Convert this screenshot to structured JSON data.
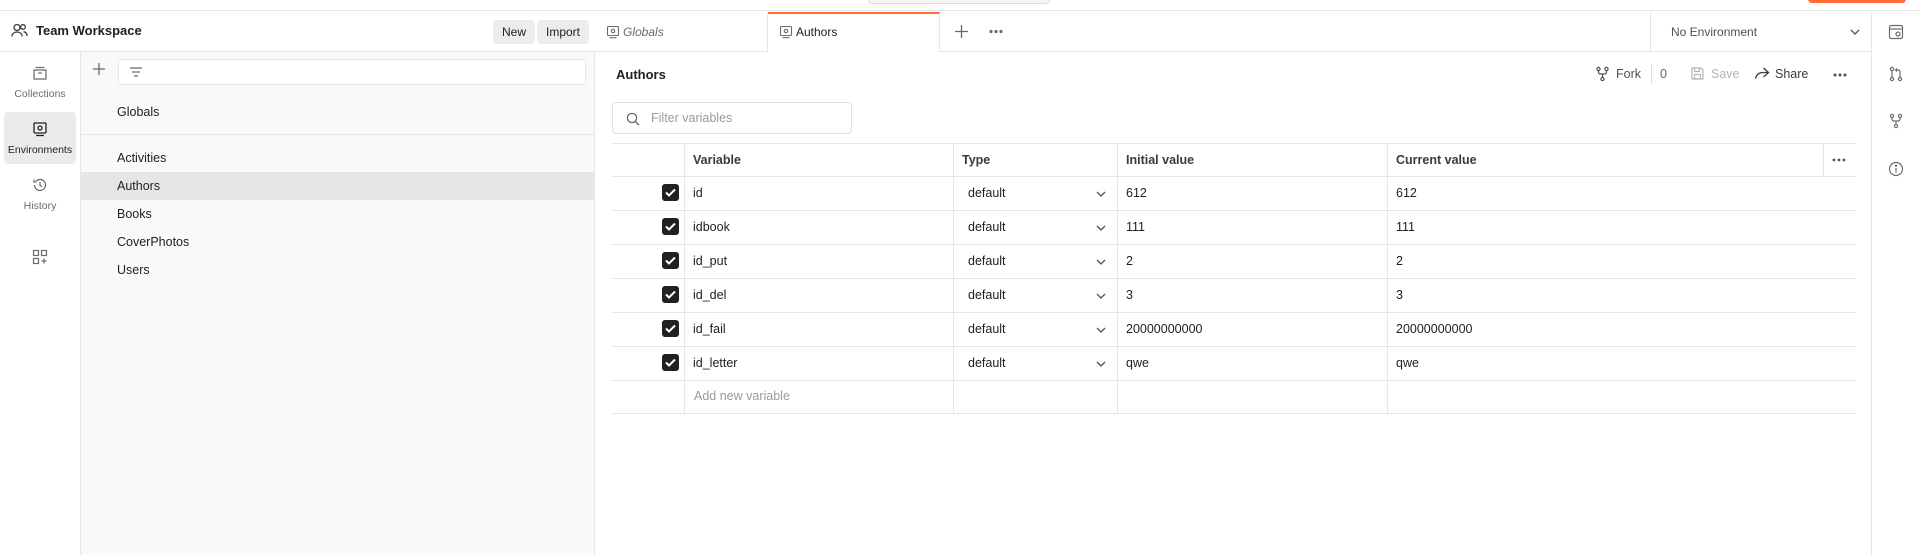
{
  "header": {
    "workspace_title": "Team Workspace",
    "new_label": "New",
    "import_label": "Import"
  },
  "rail": {
    "items": [
      {
        "label": "Collections",
        "icon": "collections-icon"
      },
      {
        "label": "Environments",
        "icon": "environments-icon"
      },
      {
        "label": "History",
        "icon": "history-icon"
      },
      {
        "label": "",
        "icon": "add-apps-icon"
      }
    ]
  },
  "environments": {
    "globals": "Globals",
    "items": [
      "Activities",
      "Authors",
      "Books",
      "CoverPhotos",
      "Users"
    ],
    "active": "Authors"
  },
  "tabs": [
    {
      "label": "Globals",
      "italic": true
    },
    {
      "label": "Authors",
      "active": true
    }
  ],
  "env_selector": {
    "label": "No Environment"
  },
  "content": {
    "title": "Authors",
    "fork_label": "Fork",
    "fork_count": "0",
    "save_label": "Save",
    "share_label": "Share",
    "search_placeholder": "Filter variables"
  },
  "table": {
    "headers": [
      "Variable",
      "Type",
      "Initial value",
      "Current value"
    ],
    "rows": [
      {
        "checked": true,
        "variable": "id",
        "type": "default",
        "initial": "612",
        "current": "612"
      },
      {
        "checked": true,
        "variable": "idbook",
        "type": "default",
        "initial": "111",
        "current": "111"
      },
      {
        "checked": true,
        "variable": "id_put",
        "type": "default",
        "initial": "2",
        "current": "2"
      },
      {
        "checked": true,
        "variable": "id_del",
        "type": "default",
        "initial": "3",
        "current": "3"
      },
      {
        "checked": true,
        "variable": "id_fail",
        "type": "default",
        "initial": "20000000000",
        "current": "20000000000"
      },
      {
        "checked": true,
        "variable": "id_letter",
        "type": "default",
        "initial": "qwe",
        "current": "qwe"
      }
    ],
    "add_new_placeholder": "Add new variable"
  },
  "colors": {
    "accent": "#ff6c37",
    "active_row": "#e6e6e6",
    "border": "#e6e6e6"
  }
}
